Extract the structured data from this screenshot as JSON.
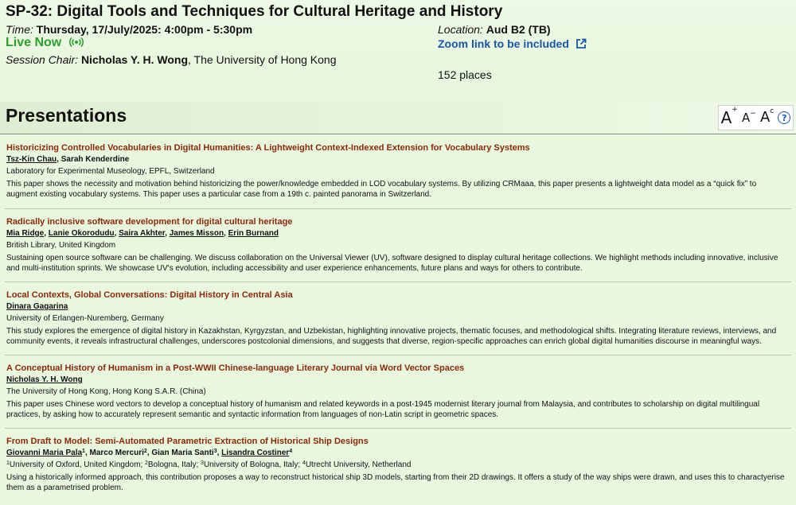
{
  "session": {
    "title": "SP-32: Digital Tools and Techniques for Cultural Heritage and History",
    "time_label": "Time:",
    "time_value": "Thursday, 17/July/2025: 4:00pm - 5:30pm",
    "live_label": "Live Now",
    "chair_label": "Session Chair:",
    "chair_name": "Nicholas Y. H. Wong",
    "chair_affil": ", The University of Hong Kong",
    "location_label": "Location:",
    "location_value": "Aud B2 (TB)",
    "zoom_label": "Zoom link to be included",
    "places": "152 places"
  },
  "presentations_heading": "Presentations",
  "tools": {
    "increase": "A",
    "decrease": "A",
    "reset": "A",
    "help": "?"
  },
  "items": [
    {
      "title": "Historicizing Controlled Vocabularies in Digital Humanities: A Lightweight Context-Indexed Extension for Vocabulary Systems",
      "authors": [
        {
          "name": "Tsz-Kin Chau",
          "sup": "",
          "underline": true,
          "sep": ", "
        },
        {
          "name": "Sarah Kenderdine",
          "sup": "",
          "underline": false,
          "sep": ""
        }
      ],
      "affiliation": "Laboratory for Experimental Museology, EPFL, Switzerland",
      "abstract": "This paper shows the necessity and motivation behind historicizing the power/knowledge embedded in LOD vocabulary systems. By utilizing CRMaaa, this paper presents a lightweight data model as a “quick fix” to augment existing vocabulary systems. This paper uses a particular case from a 19th c. painted panorama in Switzerland."
    },
    {
      "title": "Radically inclusive software development for digital cultural heritage",
      "authors": [
        {
          "name": "Mia Ridge",
          "sup": "",
          "underline": true,
          "sep": ", "
        },
        {
          "name": "Lanie Okorodudu",
          "sup": "",
          "underline": true,
          "sep": ", "
        },
        {
          "name": "Saira Akhter",
          "sup": "",
          "underline": true,
          "sep": ", "
        },
        {
          "name": "James Misson",
          "sup": "",
          "underline": true,
          "sep": ", "
        },
        {
          "name": "Erin Burnand",
          "sup": "",
          "underline": true,
          "sep": ""
        }
      ],
      "affiliation": "British Library, United Kingdom",
      "abstract": "Sustaining open source software can be challenging. We discuss collaboration on the Universal Viewer (UV), software designed to display cultural heritage collections. We highlight methods including innovative, inclusive and multi-institution sprints. We showcase UV's evolution, including accessibility and user experience enhancements, future plans and ways for others to contribute."
    },
    {
      "title": "Local Contexts, Global Conversations: Digital History in Central Asia",
      "authors": [
        {
          "name": "Dinara Gagarina",
          "sup": "",
          "underline": true,
          "sep": ""
        }
      ],
      "affiliation": "University of Erlangen-Nuremberg, Germany",
      "abstract": "This study explores the emergence of digital history in Kazakhstan, Kyrgyzstan, and Uzbekistan, highlighting innovative projects, thematic focuses, and methodological shifts. Integrating literature reviews, interviews, and community events, it reveals infrastructural challenges, underscores postcolonial dimensions, and suggests that diverse, region-specific approaches can enrich global digital humanities discourse in meaningful ways."
    },
    {
      "title": "A Conceptual History of Humanism in a Post-WWII Chinese-language Literary Journal via Word Vector Spaces",
      "authors": [
        {
          "name": "Nicholas Y. H. Wong",
          "sup": "",
          "underline": true,
          "sep": ""
        }
      ],
      "affiliation": "The University of Hong Kong, Hong Kong S.A.R. (China)",
      "abstract": "This paper uses Chinese word vectors to develop a conceptual history of humanism and related keywords in a post-1945 modernist literary journal from Malaysia, and contributes to scholarship on digital multilingual practices, by asking how to accurately represent semantic and syntactic information from languages of non-Latin script in geometric spaces."
    },
    {
      "title": "From Draft to Model: Semi-Automated Parametric Extraction of Historical Ship Designs",
      "authors": [
        {
          "name": "Giovanni Maria Pala",
          "sup": "1",
          "underline": true,
          "sep": ", "
        },
        {
          "name": "Marco Mercuri",
          "sup": "2",
          "underline": false,
          "sep": ", "
        },
        {
          "name": "Gian Maria Santi",
          "sup": "3",
          "underline": false,
          "sep": ", "
        },
        {
          "name": "Lisandra Costiner",
          "sup": "4",
          "underline": true,
          "sep": ""
        }
      ],
      "affiliations_multi": [
        {
          "sup": "1",
          "text": "University of Oxford, United Kingdom; "
        },
        {
          "sup": "2",
          "text": "Bologna, Italy; "
        },
        {
          "sup": "3",
          "text": "University of Bologna, Italy; "
        },
        {
          "sup": "4",
          "text": "Utrecht University, Netherland"
        }
      ],
      "abstract": "Using a historically informed approach, this contribution proposes a way to reconstruct historical ship 3D models, starting from their 2D drawings. It offers a study of the way ships were drawn, and uses this to charactyerise them as a parametrised problem."
    }
  ]
}
